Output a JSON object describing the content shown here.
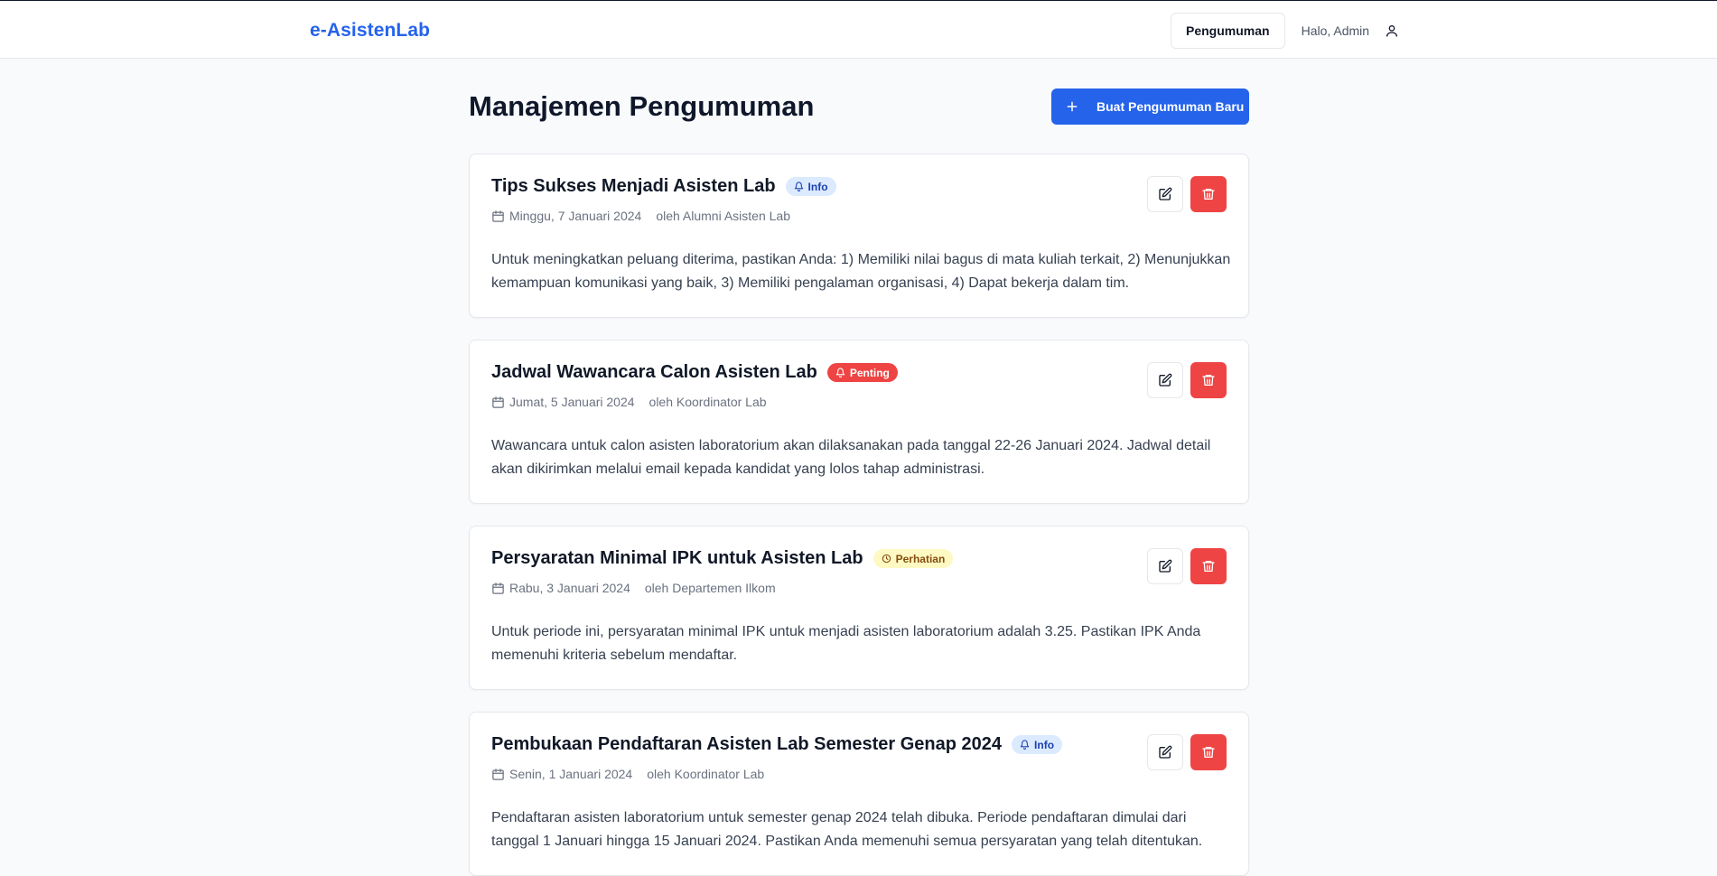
{
  "header": {
    "brand": "e-AsistenLab",
    "nav_button": "Pengumuman",
    "greeting": "Halo, Admin",
    "user_icon": "user-icon"
  },
  "main": {
    "title": "Manajemen Pengumuman",
    "new_button": "Buat Pengumuman Baru",
    "announcements": [
      {
        "title": "Tips Sukses Menjadi Asisten Lab",
        "badge": "Info",
        "badge_type": "info",
        "badge_icon": "bell-icon",
        "date": "Minggu, 7 Januari 2024",
        "author": "oleh Alumni Asisten Lab",
        "body": "Untuk meningkatkan peluang diterima, pastikan Anda: 1) Memiliki nilai bagus di mata kuliah terkait, 2) Menunjukkan kemampuan komunikasi yang baik, 3) Memiliki pengalaman organisasi, 4) Dapat bekerja dalam tim."
      },
      {
        "title": "Jadwal Wawancara Calon Asisten Lab",
        "badge": "Penting",
        "badge_type": "penting",
        "badge_icon": "bell-icon",
        "date": "Jumat, 5 Januari 2024",
        "author": "oleh Koordinator Lab",
        "body": "Wawancara untuk calon asisten laboratorium akan dilaksanakan pada tanggal 22-26 Januari 2024. Jadwal detail akan dikirimkan melalui email kepada kandidat yang lolos tahap administrasi."
      },
      {
        "title": "Persyaratan Minimal IPK untuk Asisten Lab",
        "badge": "Perhatian",
        "badge_type": "perhatian",
        "badge_icon": "clock-icon",
        "date": "Rabu, 3 Januari 2024",
        "author": "oleh Departemen Ilkom",
        "body": "Untuk periode ini, persyaratan minimal IPK untuk menjadi asisten laboratorium adalah 3.25. Pastikan IPK Anda memenuhi kriteria sebelum mendaftar."
      },
      {
        "title": "Pembukaan Pendaftaran Asisten Lab Semester Genap 2024",
        "badge": "Info",
        "badge_type": "info",
        "badge_icon": "bell-icon",
        "date": "Senin, 1 Januari 2024",
        "author": "oleh Koordinator Lab",
        "body": "Pendaftaran asisten laboratorium untuk semester genap 2024 telah dibuka. Periode pendaftaran dimulai dari tanggal 1 Januari hingga 15 Januari 2024. Pastikan Anda memenuhi semua persyaratan yang telah ditentukan."
      }
    ]
  },
  "colors": {
    "brand": "#2563eb",
    "danger": "#ef4444",
    "info_badge": "#dbeafe",
    "warning_badge": "#fef9c3"
  }
}
